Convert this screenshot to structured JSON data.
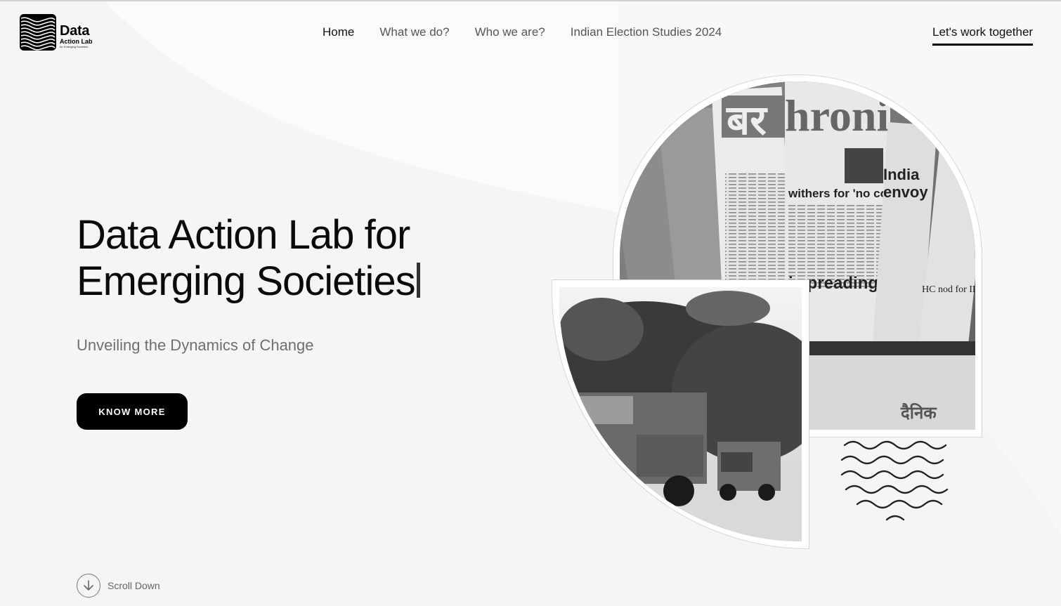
{
  "brand": {
    "title": "Data",
    "subtitle": "Action Lab",
    "tagline": "for Emerging Societies",
    "logo_icon": "wavy-lines-logo-icon"
  },
  "nav": {
    "items": [
      {
        "label": "Home",
        "active": true
      },
      {
        "label": "What we do?",
        "active": false
      },
      {
        "label": "Who we are?",
        "active": false
      },
      {
        "label": "Indian Election Studies 2024",
        "active": false
      }
    ],
    "cta_label": "Let's work together"
  },
  "hero": {
    "title_line1": "Data Action Lab for",
    "title_line2": "Emerging Societies",
    "subtitle": "Unveiling the Dynamics of Change",
    "button_label": "KNOW MORE"
  },
  "scroll": {
    "label": "Scroll Down",
    "icon": "arrow-down-icon"
  },
  "images": {
    "newspapers": {
      "description": "Stack of Hindi and English newspapers (grayscale)",
      "visible_headlines": [
        "chronicle",
        "withers for 'no comment'",
        "India envoy",
        "HC nod for IPL raps Maha govt",
        "spreading hatred among people",
        "दैनिक"
      ]
    },
    "trucks": {
      "description": "Trucks carrying people on a tree-lined road (grayscale)"
    }
  },
  "colors": {
    "background": "#f5f5f5",
    "text_primary": "#0a0a0a",
    "text_muted": "#6f6f6f",
    "button_bg": "#000000",
    "button_text": "#ffffff"
  }
}
